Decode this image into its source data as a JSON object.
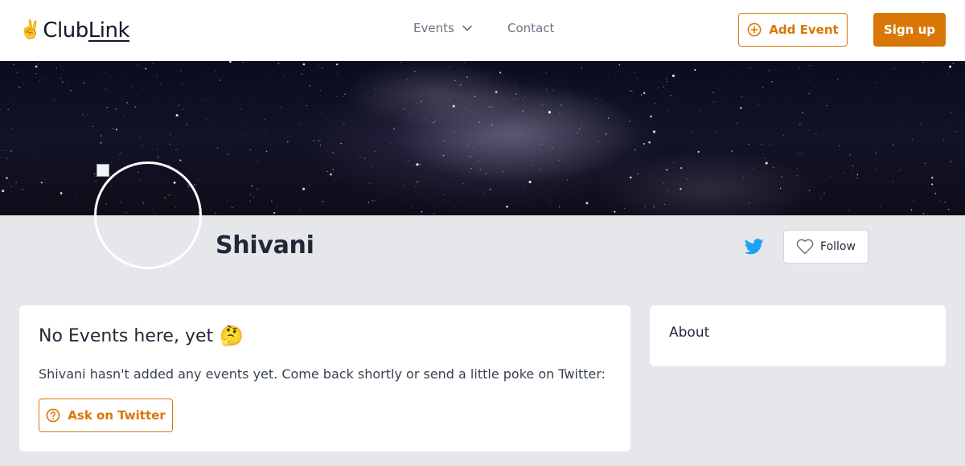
{
  "header": {
    "logo": {
      "emoji": "✌️",
      "part1": "Club",
      "part2": "Link"
    },
    "nav": {
      "events_label": "Events",
      "contact_label": "Contact"
    },
    "add_event_label": "Add Event",
    "signup_label": "Sign up"
  },
  "profile": {
    "name": "Shivani",
    "follow_label": "Follow"
  },
  "events_card": {
    "title": "No Events here, yet",
    "title_emoji": "🤔",
    "message": "Shivani hasn't added any events yet. Come back shortly or send a little poke on Twitter:",
    "ask_button_label": "Ask on Twitter"
  },
  "about_card": {
    "title": "About"
  },
  "colors": {
    "accent": "#d97706",
    "twitter": "#1da1f2",
    "page_bg": "#e5e7eb"
  }
}
